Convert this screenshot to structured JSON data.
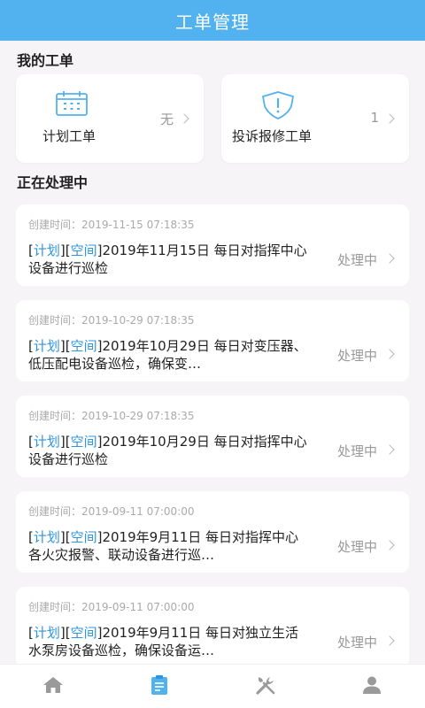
{
  "header": {
    "title": "工单管理"
  },
  "my_orders": {
    "title": "我的工单",
    "cards": [
      {
        "label": "计划工单",
        "count": "无",
        "icon": "calendar-icon"
      },
      {
        "label": "投诉报修工单",
        "count": "1",
        "icon": "shield-alert-icon"
      }
    ]
  },
  "processing": {
    "title": "正在处理中",
    "time_label": "创建时间：",
    "orders": [
      {
        "time": "2019-11-15 07:18:35",
        "tag1": "计划",
        "tag2": "空间",
        "text": "2019年11月15日 每日对指挥中心设备进行巡检",
        "status": "处理中"
      },
      {
        "time": "2019-10-29 07:18:35",
        "tag1": "计划",
        "tag2": "空间",
        "text": "2019年10月29日 每日对变压器、低压配电设备巡检，确保变…",
        "status": "处理中"
      },
      {
        "time": "2019-10-29 07:18:35",
        "tag1": "计划",
        "tag2": "空间",
        "text": "2019年10月29日 每日对指挥中心设备进行巡检",
        "status": "处理中"
      },
      {
        "time": "2019-09-11 07:00:00",
        "tag1": "计划",
        "tag2": "空间",
        "text": "2019年9月11日 每日对指挥中心各火灾报警、联动设备进行巡…",
        "status": "处理中"
      },
      {
        "time": "2019-09-11 07:00:00",
        "tag1": "计划",
        "tag2": "空间",
        "text": "2019年9月11日 每日对独立生活水泵房设备巡检，确保设备运…",
        "status": "处理中"
      }
    ]
  },
  "tabbar": {
    "items": [
      {
        "icon": "home-icon",
        "active": false
      },
      {
        "icon": "clipboard-icon",
        "active": true
      },
      {
        "icon": "tools-icon",
        "active": false
      },
      {
        "icon": "user-icon",
        "active": false
      }
    ]
  },
  "colors": {
    "accent": "#52b2ef",
    "tag": "#2f95e0",
    "icon_inactive": "#9a9a9a"
  }
}
